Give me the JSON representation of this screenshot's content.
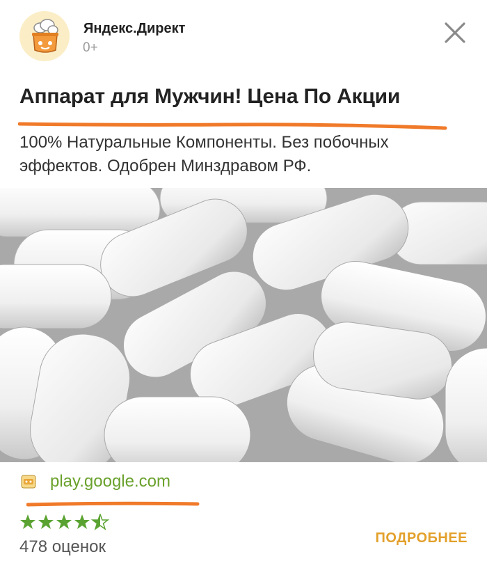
{
  "header": {
    "sponsor": "Яндекс.Директ",
    "age_rating": "0+",
    "close_icon": "close-icon"
  },
  "ad": {
    "title": "Аппарат для Мужчин! Цена По Акции",
    "description": "100% Натуральные Компоненты. Без побочных эффектов. Одобрен Минздравом РФ.",
    "image": "white-pills-photo",
    "domain": "play.google.com",
    "rating": 4.5,
    "reviews": "478 оценок",
    "more_button": "ПОДРОБНЕЕ"
  },
  "colors": {
    "accent_orange": "#f07a2a",
    "domain_green": "#6aa12c",
    "stars_green": "#5aa332",
    "button_orange": "#e3a02b"
  }
}
